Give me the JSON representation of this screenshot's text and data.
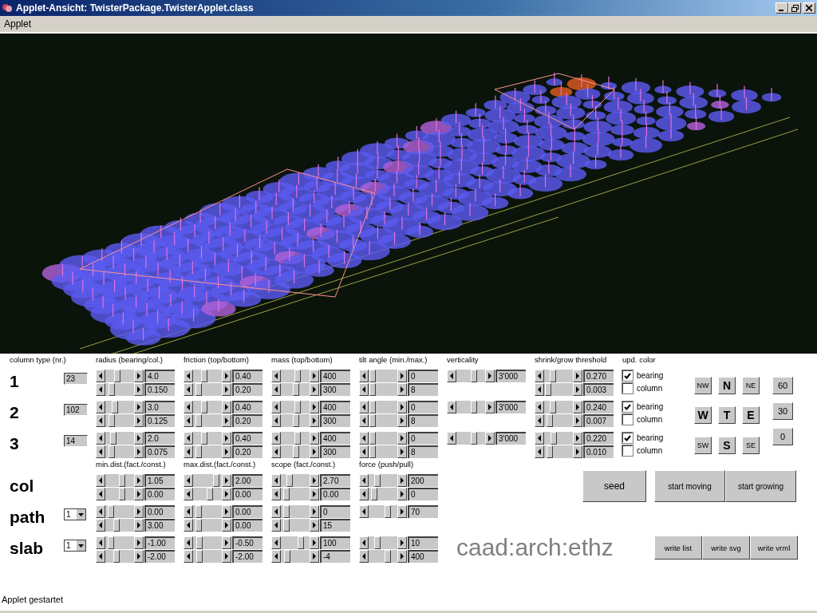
{
  "window": {
    "title": "Applet-Ansicht: TwisterPackage.TwisterApplet.class"
  },
  "menu": [
    "Applet"
  ],
  "column_types": {
    "headers": [
      "column type (nr.)",
      "radius (bearing/col.)",
      "friction (top/bottom)",
      "mass (top/bottom)",
      "tilt angle (min./max.)",
      "verticality",
      "shrink/grow threshold",
      "upd. color"
    ],
    "rows": [
      {
        "label": "1",
        "nr": "23",
        "groups": [
          {
            "sliders": [
              {
                "level": 0.4,
                "value": "4.0"
              },
              {
                "level": 0.15,
                "value": "0.150"
              }
            ]
          },
          {
            "sliders": [
              {
                "level": 0.35,
                "value": "0.40"
              },
              {
                "level": 0.1,
                "value": "0.20"
              }
            ]
          },
          {
            "sliders": [
              {
                "level": 0.6,
                "value": "400"
              },
              {
                "level": 0.55,
                "value": "300"
              }
            ]
          },
          {
            "sliders": [
              {
                "level": 0.05,
                "value": "0"
              },
              {
                "level": 0.05,
                "value": "8"
              }
            ]
          },
          {
            "sliders": [
              {
                "level": 0.65,
                "value": "3'000"
              }
            ]
          },
          {
            "sliders": [
              {
                "level": 0.25,
                "value": "0.270"
              },
              {
                "level": 0.05,
                "value": "0.003"
              }
            ]
          }
        ],
        "checkboxes": [
          {
            "label": "bearing",
            "checked": true
          },
          {
            "label": "column",
            "checked": false
          }
        ]
      },
      {
        "label": "2",
        "nr": "102",
        "groups": [
          {
            "sliders": [
              {
                "level": 0.3,
                "value": "3.0"
              },
              {
                "level": 0.15,
                "value": "0.125"
              }
            ]
          },
          {
            "sliders": [
              {
                "level": 0.35,
                "value": "0.40"
              },
              {
                "level": 0.1,
                "value": "0.20"
              }
            ]
          },
          {
            "sliders": [
              {
                "level": 0.6,
                "value": "400"
              },
              {
                "level": 0.55,
                "value": "300"
              }
            ]
          },
          {
            "sliders": [
              {
                "level": 0.05,
                "value": "0"
              },
              {
                "level": 0.05,
                "value": "8"
              }
            ]
          },
          {
            "sliders": [
              {
                "level": 0.65,
                "value": "3'000"
              }
            ]
          },
          {
            "sliders": [
              {
                "level": 0.25,
                "value": "0.240"
              },
              {
                "level": 0.1,
                "value": "0.007"
              }
            ]
          }
        ],
        "checkboxes": [
          {
            "label": "bearing",
            "checked": true
          },
          {
            "label": "column",
            "checked": false
          }
        ]
      },
      {
        "label": "3",
        "nr": "14",
        "groups": [
          {
            "sliders": [
              {
                "level": 0.2,
                "value": "2.0"
              },
              {
                "level": 0.15,
                "value": "0.075"
              }
            ]
          },
          {
            "sliders": [
              {
                "level": 0.35,
                "value": "0.40"
              },
              {
                "level": 0.1,
                "value": "0.20"
              }
            ]
          },
          {
            "sliders": [
              {
                "level": 0.6,
                "value": "400"
              },
              {
                "level": 0.55,
                "value": "300"
              }
            ]
          },
          {
            "sliders": [
              {
                "level": 0.05,
                "value": "0"
              },
              {
                "level": 0.05,
                "value": "8"
              }
            ]
          },
          {
            "sliders": [
              {
                "level": 0.65,
                "value": "3'000"
              }
            ]
          },
          {
            "sliders": [
              {
                "level": 0.3,
                "value": "0.220"
              },
              {
                "level": 0.1,
                "value": "0.010"
              }
            ]
          }
        ],
        "checkboxes": [
          {
            "label": "bearing",
            "checked": true
          },
          {
            "label": "column",
            "checked": false
          }
        ]
      }
    ]
  },
  "forces": {
    "headers": [
      "min.dist.(fact./const.)",
      "max.dist.(fact./const.)",
      "scope (fact./const.)",
      "force (push/pull)"
    ],
    "rows": [
      {
        "label": "col",
        "groups": [
          {
            "sliders": [
              {
                "level": 0.6,
                "value": "1.05"
              },
              {
                "level": 0.6,
                "value": "0.00"
              }
            ]
          },
          {
            "sliders": [
              {
                "level": 0.9,
                "value": "2.00"
              },
              {
                "level": 0.6,
                "value": "0.00"
              }
            ]
          },
          {
            "sliders": [
              {
                "level": 0.25,
                "value": "2.70"
              },
              {
                "level": 0.1,
                "value": "0.00"
              }
            ]
          },
          {
            "sliders": [
              {
                "level": 0.25,
                "value": "200"
              },
              {
                "level": 0.1,
                "value": "0"
              }
            ]
          }
        ]
      },
      {
        "label": "path",
        "dropdown": "1",
        "groups": [
          {
            "sliders": [
              {
                "level": 0.1,
                "value": "0.00"
              },
              {
                "level": 0.35,
                "value": "3.00"
              }
            ]
          },
          {
            "sliders": [
              {
                "level": 0.1,
                "value": "0.00"
              },
              {
                "level": 0.1,
                "value": "0.00"
              }
            ]
          },
          {
            "sliders": [
              {
                "level": 0.1,
                "value": "0"
              },
              {
                "level": 0.1,
                "value": "15"
              }
            ]
          },
          {
            "sliders": [
              {
                "level": 0.7,
                "value": "70"
              }
            ]
          }
        ]
      },
      {
        "label": "slab",
        "dropdown": "1",
        "groups": [
          {
            "sliders": [
              {
                "level": 0.1,
                "value": "-1.00"
              },
              {
                "level": 0.35,
                "value": "-2.00"
              }
            ]
          },
          {
            "sliders": [
              {
                "level": 0.15,
                "value": "-0.50"
              },
              {
                "level": 0.15,
                "value": "-2.00"
              }
            ]
          },
          {
            "sliders": [
              {
                "level": 0.75,
                "value": "100"
              },
              {
                "level": 0.15,
                "value": "-4"
              }
            ]
          },
          {
            "sliders": [
              {
                "level": 0.25,
                "value": "10"
              },
              {
                "level": 0.7,
                "value": "400"
              }
            ]
          }
        ]
      }
    ]
  },
  "view_buttons": [
    {
      "label": "NW",
      "kind": "minor"
    },
    {
      "label": "N",
      "kind": "major"
    },
    {
      "label": "NE",
      "kind": "minor"
    },
    {
      "label": "W",
      "kind": "major"
    },
    {
      "label": "T",
      "kind": "major"
    },
    {
      "label": "E",
      "kind": "major"
    },
    {
      "label": "SW",
      "kind": "minor"
    },
    {
      "label": "S",
      "kind": "major"
    },
    {
      "label": "SE",
      "kind": "minor"
    }
  ],
  "angle_buttons": [
    "60",
    "30",
    "0"
  ],
  "action_buttons": [
    "seed",
    "start moving",
    "start growing"
  ],
  "logo": "caad:arch:ethz",
  "write_buttons": [
    "write list",
    "write svg",
    "write vrml"
  ],
  "status_bar": "Applet gestartet"
}
